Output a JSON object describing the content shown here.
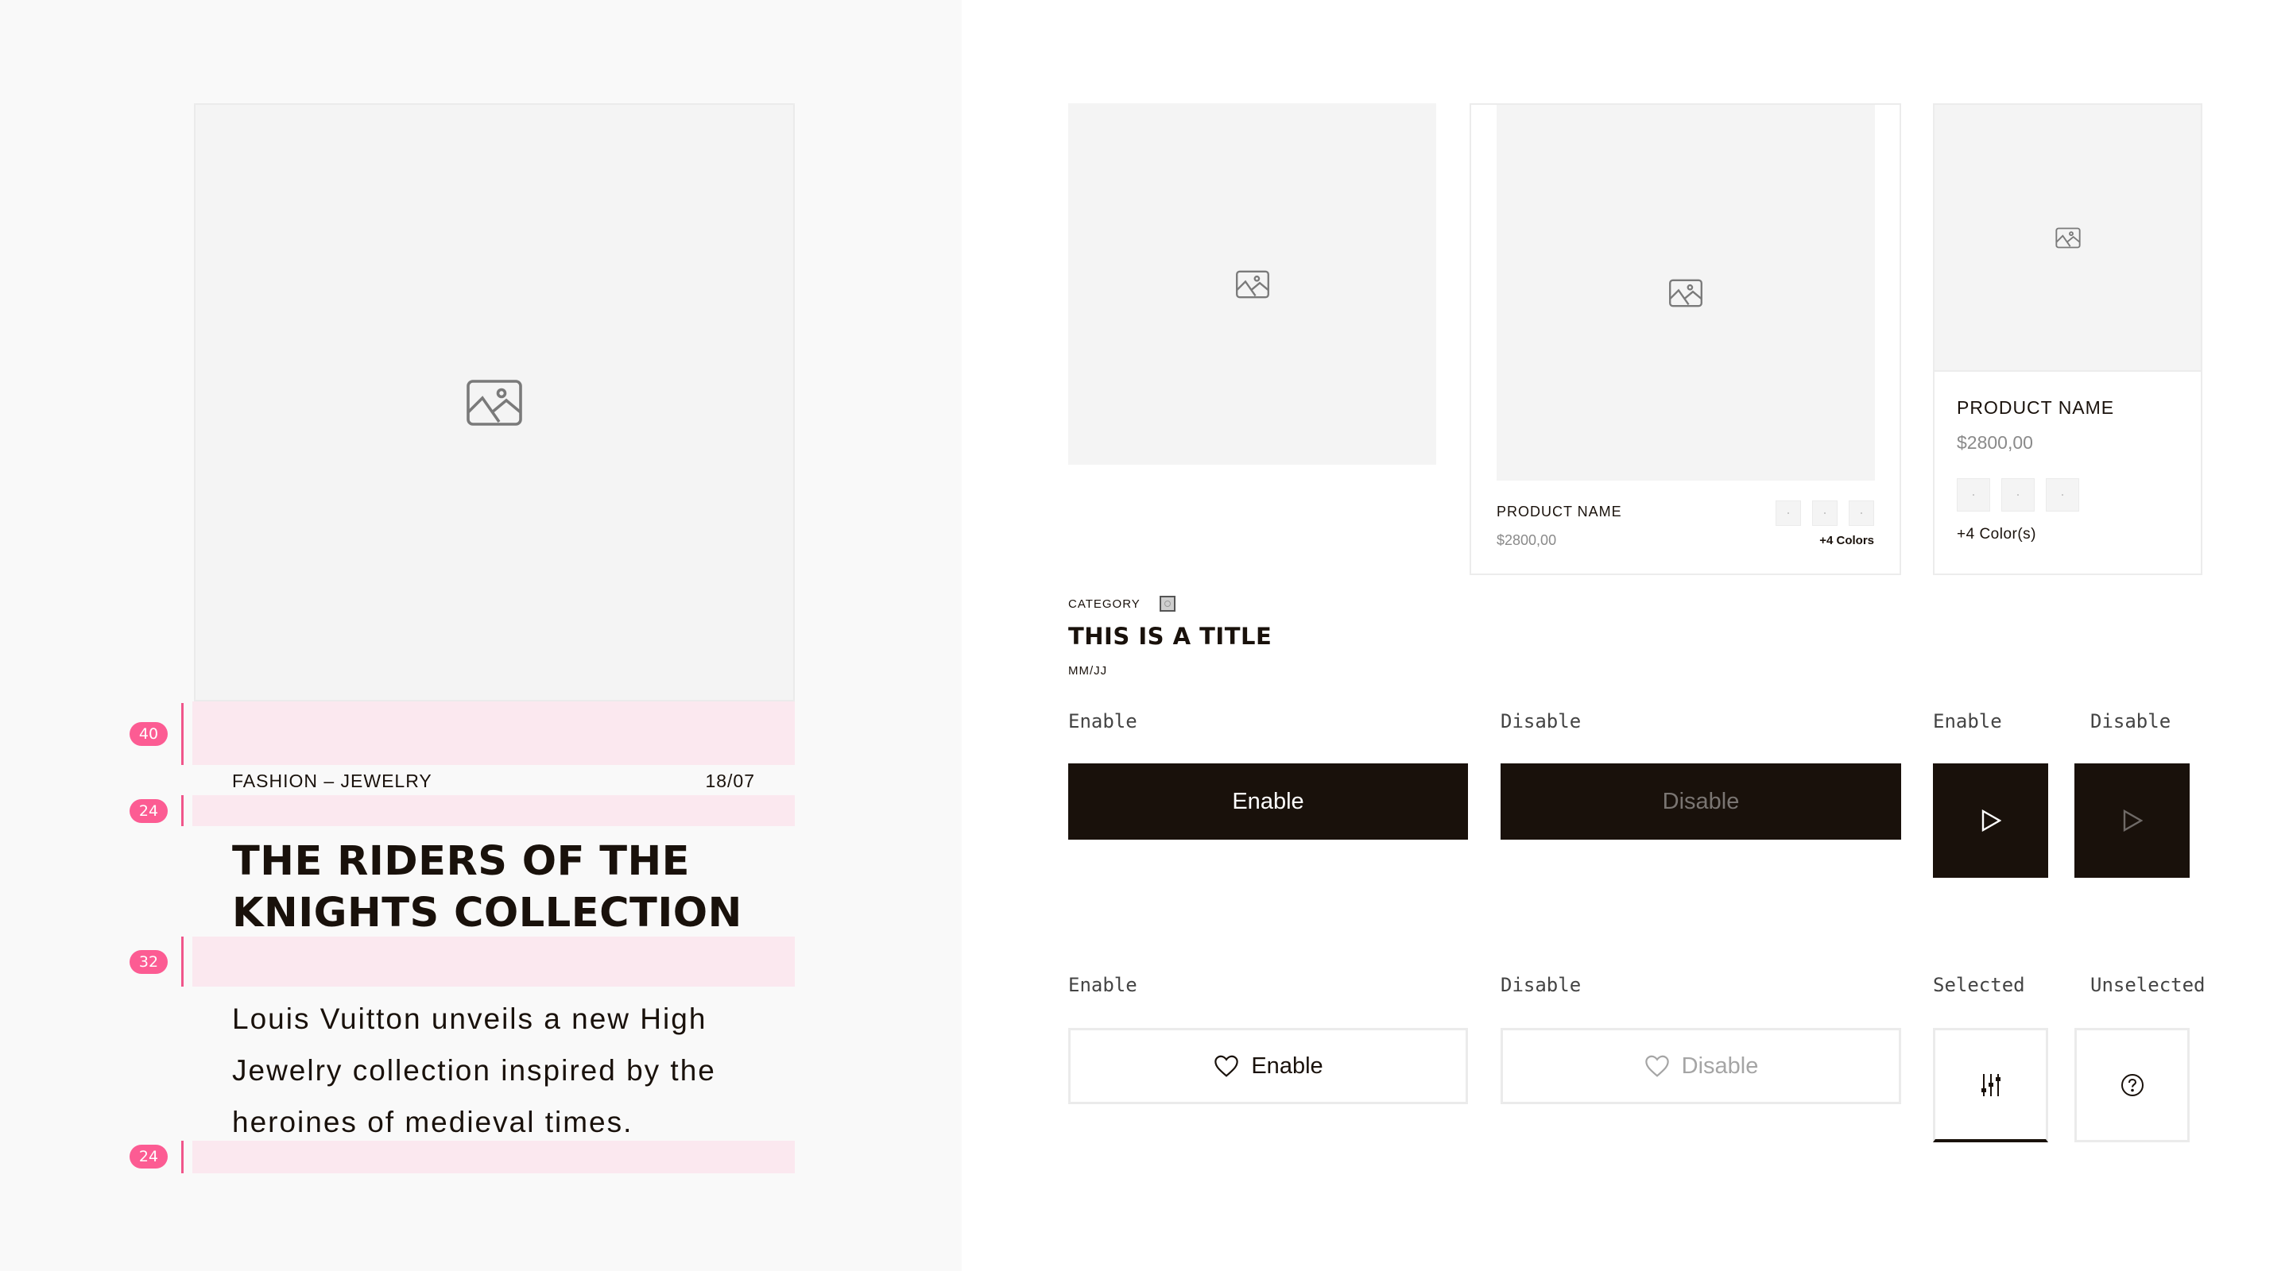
{
  "colors": {
    "dark": "#19110b",
    "spacing_marker": "#fc5c93",
    "spacing_band": "#fbe8ef",
    "placeholder": "#f4f4f4",
    "disabled_text": "#a5a5a5"
  },
  "article": {
    "image_icon": "image-placeholder-icon",
    "category": "FASHION – JEWELRY",
    "date": "18/07",
    "title_lines": [
      "THE RIDERS OF THE",
      "KNIGHTS COLLECTION"
    ],
    "body_lines": [
      "Louis Vuitton unveils a new High",
      "Jewelry collection inspired by the",
      "heroines of medieval times."
    ],
    "spacing_markers": [
      "40",
      "24",
      "32",
      "24"
    ]
  },
  "cards": {
    "editorial": {
      "category": "CATEGORY",
      "title": "THIS IS A TITLE",
      "date": "MM/JJ"
    },
    "product_wide": {
      "name": "PRODUCT NAME",
      "price": "$2800,00",
      "more_colors": "+4 Colors",
      "swatch_count": 3
    },
    "product_narrow": {
      "name": "PRODUCT NAME",
      "price": "$2800,00",
      "more_colors": "+4 Color(s)",
      "swatch_count": 3
    }
  },
  "buttons": {
    "primary": {
      "enable_label": "Enable",
      "disable_label": "Disable",
      "enable_text": "Enable",
      "disable_text": "Disable"
    },
    "primary_icon": {
      "enable_label": "Enable",
      "disable_label": "Disable",
      "icon": "play-icon"
    },
    "secondary": {
      "enable_label": "Enable",
      "disable_label": "Disable",
      "enable_text": "Enable",
      "disable_text": "Disable",
      "icon": "heart-icon"
    },
    "toggle_icon": {
      "selected_label": "Selected",
      "unselected_label": "Unselected",
      "selected_icon": "filter-sliders-icon",
      "unselected_icon": "help-circle-icon"
    }
  }
}
